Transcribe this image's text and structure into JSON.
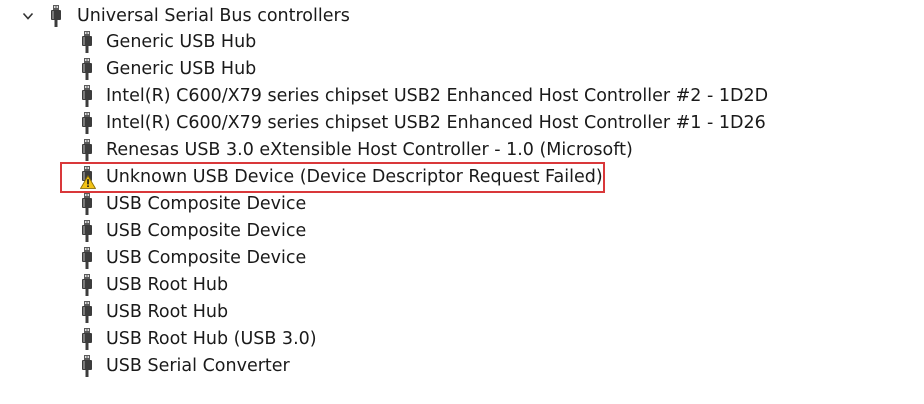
{
  "category": {
    "label": "Universal Serial Bus controllers",
    "expanded": true,
    "icon": "usb-plug-icon",
    "chevron_icon": "chevron-down-icon"
  },
  "devices": [
    {
      "label": "Generic USB Hub",
      "icon": "usb-plug-icon",
      "warning": false
    },
    {
      "label": "Generic USB Hub",
      "icon": "usb-plug-icon",
      "warning": false
    },
    {
      "label": "Intel(R) C600/X79 series chipset USB2 Enhanced Host Controller #2 - 1D2D",
      "icon": "usb-plug-icon",
      "warning": false
    },
    {
      "label": "Intel(R) C600/X79 series chipset USB2 Enhanced Host Controller #1 - 1D26",
      "icon": "usb-plug-icon",
      "warning": false
    },
    {
      "label": "Renesas USB 3.0 eXtensible Host Controller - 1.0 (Microsoft)",
      "icon": "usb-plug-icon",
      "warning": false
    },
    {
      "label": "Unknown USB Device (Device Descriptor Request Failed)",
      "icon": "warning-icon",
      "warning": true
    },
    {
      "label": "USB Composite Device",
      "icon": "usb-plug-icon",
      "warning": false
    },
    {
      "label": "USB Composite Device",
      "icon": "usb-plug-icon",
      "warning": false
    },
    {
      "label": "USB Composite Device",
      "icon": "usb-plug-icon",
      "warning": false
    },
    {
      "label": "USB Root Hub",
      "icon": "usb-plug-icon",
      "warning": false
    },
    {
      "label": "USB Root Hub",
      "icon": "usb-plug-icon",
      "warning": false
    },
    {
      "label": "USB Root Hub (USB 3.0)",
      "icon": "usb-plug-icon",
      "warning": false
    },
    {
      "label": "USB Serial Converter",
      "icon": "usb-plug-icon",
      "warning": false
    }
  ],
  "highlight": {
    "target": "Unknown USB Device (Device Descriptor Request Failed)",
    "color": "#d9383a"
  }
}
